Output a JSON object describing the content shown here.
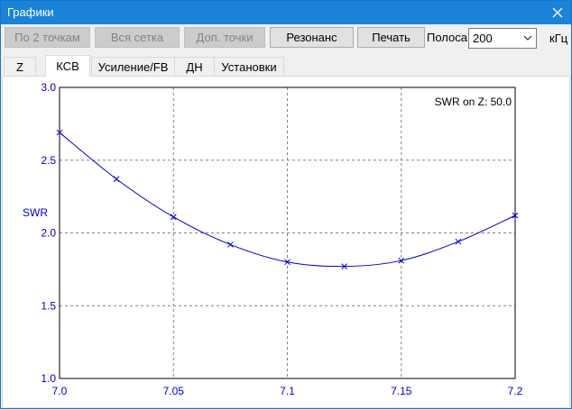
{
  "window": {
    "title": "Графики"
  },
  "toolbar": {
    "btn_two_points": "По 2 точкам",
    "btn_full_grid": "Вся сетка",
    "btn_add_points": "Доп. точки",
    "btn_resonance": "Резонанс",
    "btn_print": "Печать",
    "band_label": "Полоса",
    "band_value": "200",
    "band_unit": "кГц"
  },
  "tabs": [
    {
      "label": "Z"
    },
    {
      "label": "КСВ",
      "active": true
    },
    {
      "label": "Усиление/FB"
    },
    {
      "label": "ДН"
    },
    {
      "label": "Установки"
    }
  ],
  "colors": {
    "titlebar": "#1883d7",
    "curve": "#0000cc",
    "axis_text": "#0000cc"
  },
  "chart_data": {
    "type": "line",
    "annotation": "SWR on Z: 50.0",
    "ylabel": "SWR",
    "xlabel": "",
    "xlim": [
      7.0,
      7.2
    ],
    "ylim": [
      1.0,
      3.0
    ],
    "x_ticks": [
      "7.0",
      "7.05",
      "7.1",
      "7.15",
      "7.2"
    ],
    "y_ticks": [
      "3.0",
      "2.5",
      "2.0",
      "1.5",
      "1.0"
    ],
    "grid": true,
    "series": [
      {
        "x": [
          7.0,
          7.025,
          7.05,
          7.075,
          7.1,
          7.125,
          7.15,
          7.175,
          7.2
        ],
        "values": [
          2.69,
          2.37,
          2.11,
          1.92,
          1.8,
          1.77,
          1.81,
          1.94,
          2.12
        ]
      }
    ]
  }
}
